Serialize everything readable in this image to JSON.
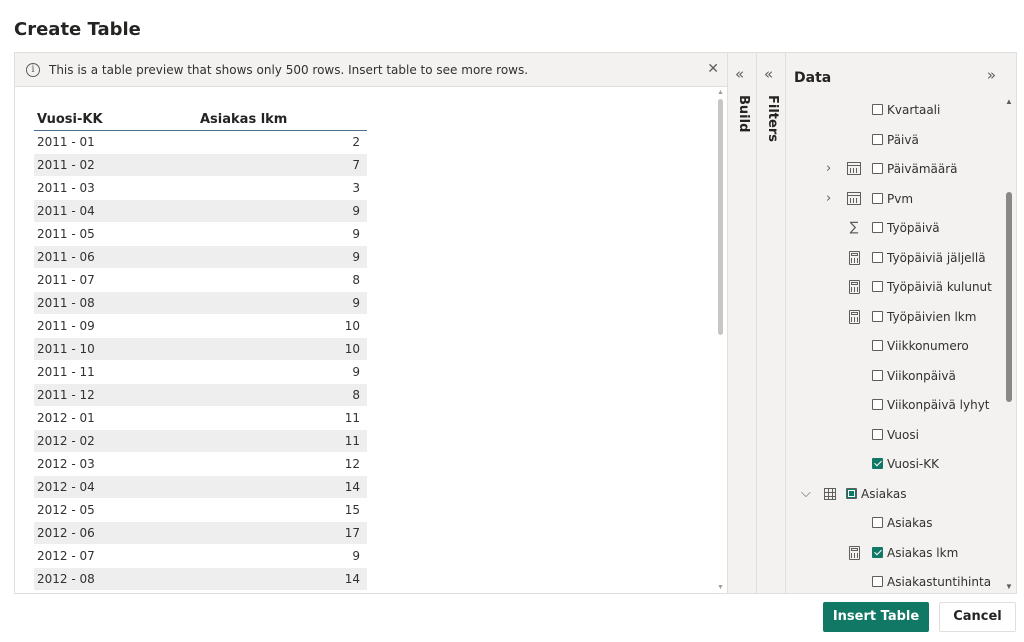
{
  "dialog": {
    "title": "Create Table",
    "banner_message": "This is a table preview that shows only 500 rows. Insert table to see more rows.",
    "insert_label": "Insert Table",
    "cancel_label": "Cancel"
  },
  "icons": {
    "info": "info-icon",
    "close": "close-icon",
    "collapse": "double-chevron-left-icon",
    "expand": "double-chevron-right-icon"
  },
  "preview_table": {
    "headers": [
      "Vuosi-KK",
      "Asiakas lkm"
    ],
    "rows": [
      [
        "2011 - 01",
        "2"
      ],
      [
        "2011 - 02",
        "7"
      ],
      [
        "2011 - 03",
        "3"
      ],
      [
        "2011 - 04",
        "9"
      ],
      [
        "2011 - 05",
        "9"
      ],
      [
        "2011 - 06",
        "9"
      ],
      [
        "2011 - 07",
        "8"
      ],
      [
        "2011 - 08",
        "9"
      ],
      [
        "2011 - 09",
        "10"
      ],
      [
        "2011 - 10",
        "10"
      ],
      [
        "2011 - 11",
        "9"
      ],
      [
        "2011 - 12",
        "8"
      ],
      [
        "2012 - 01",
        "11"
      ],
      [
        "2012 - 02",
        "11"
      ],
      [
        "2012 - 03",
        "12"
      ],
      [
        "2012 - 04",
        "14"
      ],
      [
        "2012 - 05",
        "15"
      ],
      [
        "2012 - 06",
        "17"
      ],
      [
        "2012 - 07",
        "9"
      ],
      [
        "2012 - 08",
        "14"
      ]
    ]
  },
  "side_tabs": {
    "build": "Build",
    "filters": "Filters"
  },
  "data_pane": {
    "header": "Data",
    "fields": [
      {
        "label": "Kvartaali",
        "checked": false,
        "icon": "none",
        "expandable": false
      },
      {
        "label": "Päivä",
        "checked": false,
        "icon": "none",
        "expandable": false
      },
      {
        "label": "Päivämäärä",
        "checked": false,
        "icon": "calendar-icon",
        "expandable": true
      },
      {
        "label": "Pvm",
        "checked": false,
        "icon": "calendar-icon",
        "expandable": true
      },
      {
        "label": "Työpäivä",
        "checked": false,
        "icon": "sigma-icon",
        "expandable": false
      },
      {
        "label": "Työpäiviä jäljellä",
        "checked": false,
        "icon": "calculator-icon",
        "expandable": false
      },
      {
        "label": "Työpäiviä kulunut",
        "checked": false,
        "icon": "calculator-icon",
        "expandable": false
      },
      {
        "label": "Työpäivien lkm",
        "checked": false,
        "icon": "calculator-icon",
        "expandable": false
      },
      {
        "label": "Viikkonumero",
        "checked": false,
        "icon": "none",
        "expandable": false
      },
      {
        "label": "Viikonpäivä",
        "checked": false,
        "icon": "none",
        "expandable": false
      },
      {
        "label": "Viikonpäivä lyhyt",
        "checked": false,
        "icon": "none",
        "expandable": false
      },
      {
        "label": "Vuosi",
        "checked": false,
        "icon": "none",
        "expandable": false
      },
      {
        "label": "Vuosi-KK",
        "checked": true,
        "icon": "none",
        "expandable": false
      }
    ],
    "table_group": {
      "label": "Asiakas",
      "icon": "table-icon",
      "expanded": true
    },
    "table_fields": [
      {
        "label": "Asiakas",
        "checked": false,
        "icon": "none"
      },
      {
        "label": "Asiakas lkm",
        "checked": true,
        "icon": "calculator-icon"
      },
      {
        "label": "Asiakastuntihinta",
        "checked": false,
        "icon": "none"
      }
    ]
  },
  "colors": {
    "accent": "#117865",
    "header_underline": "#4a6e8f",
    "pane_bg": "#f3f2f1"
  }
}
